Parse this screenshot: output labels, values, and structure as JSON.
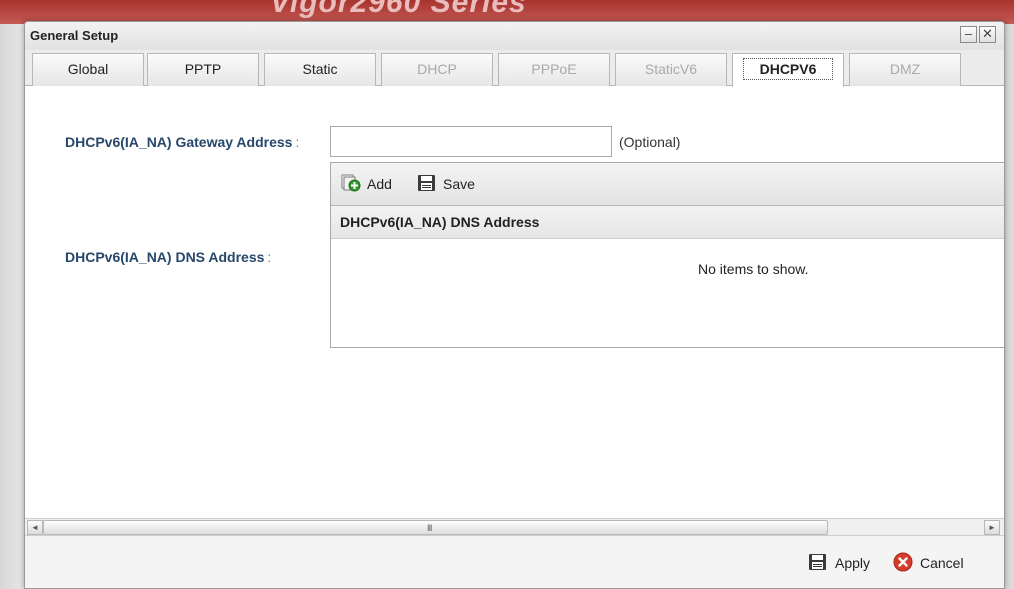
{
  "background": {
    "title_fragment": "Vigor2960 Series"
  },
  "dialog": {
    "title": "General Setup",
    "minimize_glyph": "–",
    "close_glyph": "✕"
  },
  "tabs": [
    {
      "label": "Global",
      "state": "enabled"
    },
    {
      "label": "PPTP",
      "state": "enabled"
    },
    {
      "label": "Static",
      "state": "enabled"
    },
    {
      "label": "DHCP",
      "state": "disabled"
    },
    {
      "label": "PPPoE",
      "state": "disabled"
    },
    {
      "label": "StaticV6",
      "state": "disabled"
    },
    {
      "label": "DHCPV6",
      "state": "active"
    },
    {
      "label": "DMZ",
      "state": "disabled"
    }
  ],
  "form": {
    "gateway": {
      "label": "DHCPv6(IA_NA) Gateway Address",
      "colon": ":",
      "value": "",
      "hint": "(Optional)"
    },
    "dns": {
      "label": "DHCPv6(IA_NA) DNS Address",
      "colon": ":"
    }
  },
  "dns_grid": {
    "toolbar": {
      "add_label": "Add",
      "save_label": "Save"
    },
    "column_header": "DHCPv6(IA_NA) DNS Address",
    "empty_text": "No items to show."
  },
  "scrollbar": {
    "grip": "III",
    "left_arrow": "◄",
    "right_arrow": "►"
  },
  "footer": {
    "apply_label": "Apply",
    "cancel_label": "Cancel"
  },
  "colors": {
    "label_text": "#27476b",
    "add_icon_green": "#2e9a2b",
    "cancel_icon_red": "#d63a2b",
    "header_red": "#a8332e"
  }
}
